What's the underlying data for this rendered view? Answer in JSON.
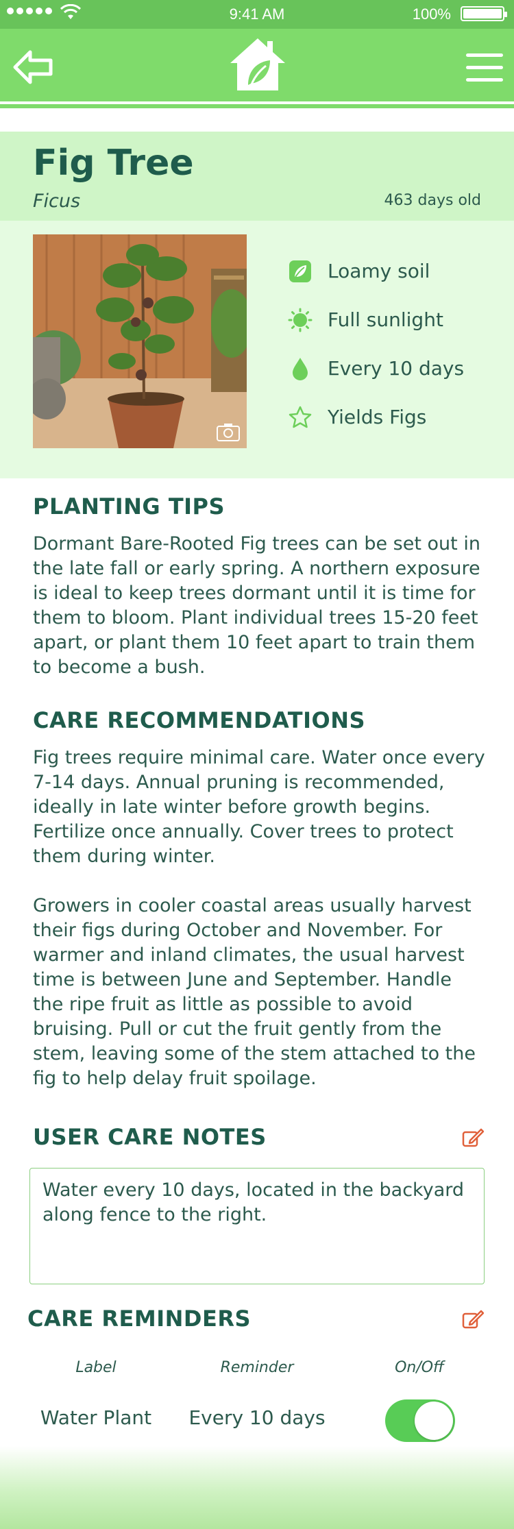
{
  "status_bar": {
    "time": "9:41 AM",
    "battery": "100%"
  },
  "plant": {
    "name": "Fig Tree",
    "latin_name": "Ficus",
    "age": "463 days old",
    "attributes": [
      {
        "icon": "leaf-icon",
        "label": "Loamy soil"
      },
      {
        "icon": "sun-icon",
        "label": "Full sunlight"
      },
      {
        "icon": "water-drop-icon",
        "label": "Every 10 days"
      },
      {
        "icon": "star-icon",
        "label": "Yields Figs"
      }
    ]
  },
  "planting_tips": {
    "title": "PLANTING TIPS",
    "text": "Dormant Bare-Rooted Fig trees can be set out in the late fall or early spring.  A northern exposure is ideal to keep trees dormant until it is time for them to bloom.  Plant individual trees 15-20 feet apart, or plant them 10 feet apart to train them to become a bush."
  },
  "care_recommendations": {
    "title": "CARE RECOMMENDATIONS",
    "paragraphs": [
      "Fig trees require minimal care.  Water once every 7-14 days.  Annual pruning is recommended, ideally in late winter before growth begins.  Fertilize once annually.  Cover trees to protect them during winter.",
      "Growers in cooler coastal areas usually harvest their figs during October and November. For warmer and inland climates, the usual harvest time is between June and September.   Handle the ripe fruit as little as possible to avoid bruising. Pull or cut the fruit gently from the stem, leaving some of the stem attached to the fig to help delay fruit spoilage."
    ]
  },
  "user_care_notes": {
    "title": "USER CARE NOTES",
    "text": "Water every 10 days, located in the backyard along fence to the right."
  },
  "care_reminders": {
    "title": "CARE REMINDERS",
    "headers": {
      "label": "Label",
      "reminder": "Reminder",
      "toggle": "On/Off"
    },
    "items": [
      {
        "label": "Water Plant",
        "reminder": "Every 10 days",
        "enabled": true
      }
    ]
  },
  "colors": {
    "nav_green": "#7fdb6b",
    "status_green": "#68c35a",
    "title_panel": "#cff5c7",
    "info_panel": "#e5fbe1",
    "heading_text": "#1f5c4c",
    "accent_orange": "#e0603a",
    "toggle_on": "#58cc56"
  }
}
